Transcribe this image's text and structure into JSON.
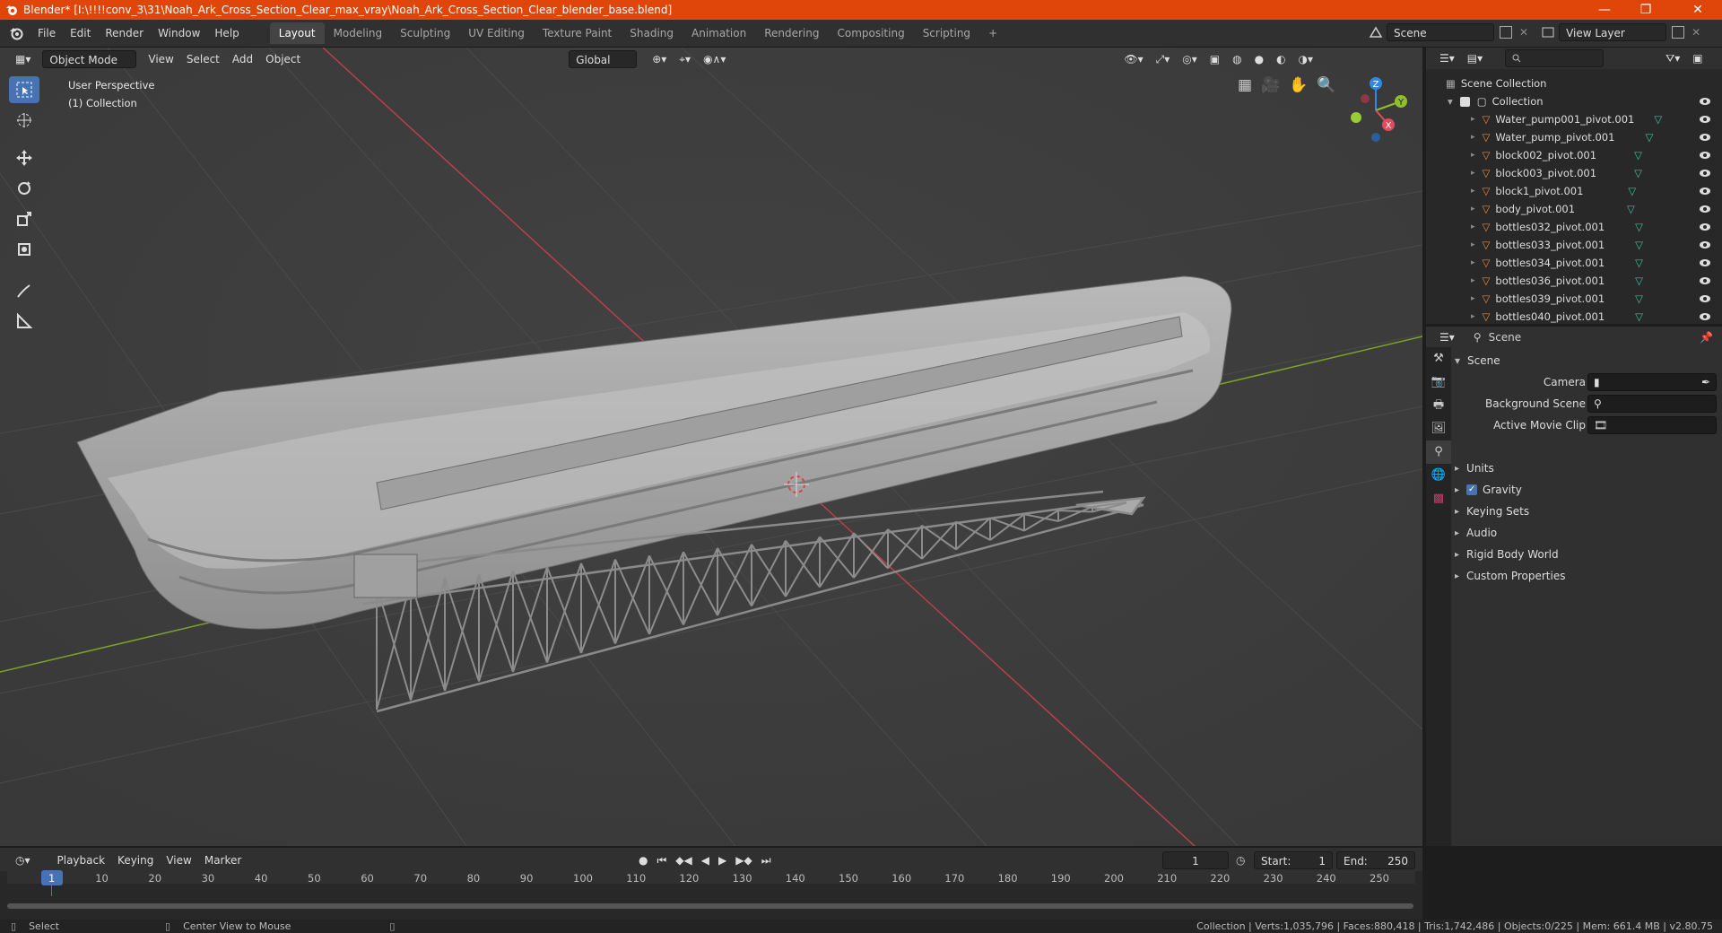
{
  "window": {
    "title": "Blender* [I:\\!!!!conv_3\\31\\Noah_Ark_Cross_Section_Clear_max_vray\\Noah_Ark_Cross_Section_Clear_blender_base.blend]",
    "minimize": "—",
    "maximize": "❐",
    "close": "✕"
  },
  "menu": [
    "File",
    "Edit",
    "Render",
    "Window",
    "Help"
  ],
  "workspaces": [
    "Layout",
    "Modeling",
    "Sculpting",
    "UV Editing",
    "Texture Paint",
    "Shading",
    "Animation",
    "Rendering",
    "Compositing",
    "Scripting"
  ],
  "workspace_add": "+",
  "scene_field": "Scene",
  "view_layer_field": "View Layer",
  "viewport": {
    "mode": "Object Mode",
    "menus": [
      "View",
      "Select",
      "Add",
      "Object"
    ],
    "transform": "Global",
    "overlay_line1": "User Perspective",
    "overlay_line2": "(1) Collection",
    "gizmo": {
      "z": "Z",
      "y": "Y",
      "x": "X"
    }
  },
  "outliner": {
    "root": "Scene Collection",
    "collection": "Collection",
    "items": [
      "Water_pump001_pivot.001",
      "Water_pump_pivot.001",
      "block002_pivot.001",
      "block003_pivot.001",
      "block1_pivot.001",
      "body_pivot.001",
      "bottles032_pivot.001",
      "bottles033_pivot.001",
      "bottles034_pivot.001",
      "bottles036_pivot.001",
      "bottles039_pivot.001",
      "bottles040_pivot.001"
    ]
  },
  "properties": {
    "context": "Scene",
    "panel": "Scene",
    "camera_label": "Camera",
    "background_label": "Background Scene",
    "movieclip_label": "Active Movie Clip",
    "sections": [
      "Units",
      "Gravity",
      "Keying Sets",
      "Audio",
      "Rigid Body World",
      "Custom Properties"
    ]
  },
  "timeline": {
    "menus": [
      "Playback",
      "Keying",
      "View",
      "Marker"
    ],
    "current_frame": "1",
    "start_label": "Start:",
    "start": "1",
    "end_label": "End:",
    "end": "250",
    "ticks": [
      "1",
      "10",
      "20",
      "30",
      "40",
      "50",
      "60",
      "70",
      "80",
      "90",
      "100",
      "110",
      "120",
      "130",
      "140",
      "150",
      "160",
      "170",
      "180",
      "190",
      "200",
      "210",
      "220",
      "230",
      "240",
      "250"
    ]
  },
  "status": {
    "left1": "Select",
    "left2": "Center View to Mouse",
    "right": "Collection | Verts:1,035,796 | Faces:880,418 | Tris:1,742,486 | Objects:0/225 | Mem: 661.4 MB | v2.80.75"
  },
  "colors": {
    "title_bg": "#e0460a",
    "accent": "#4772b3",
    "axis_x": "#e44a5c",
    "axis_y": "#8fbf2a",
    "axis_z": "#2e88e8"
  }
}
